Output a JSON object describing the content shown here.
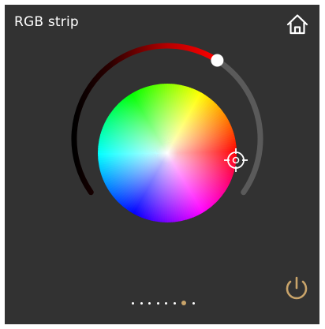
{
  "header": {
    "title": "RGB strip"
  },
  "icons": {
    "home": "home-icon",
    "power": "power-icon",
    "color_picker": "crosshair-icon"
  },
  "brightness": {
    "level": 0.63,
    "color": "#ff0000"
  },
  "pager": {
    "count": 8,
    "active_index": 6,
    "active_color": "#c9a46a"
  },
  "colors": {
    "background": "#323232",
    "accent": "#c9a46a",
    "track_gray": "#5a5a5a"
  }
}
